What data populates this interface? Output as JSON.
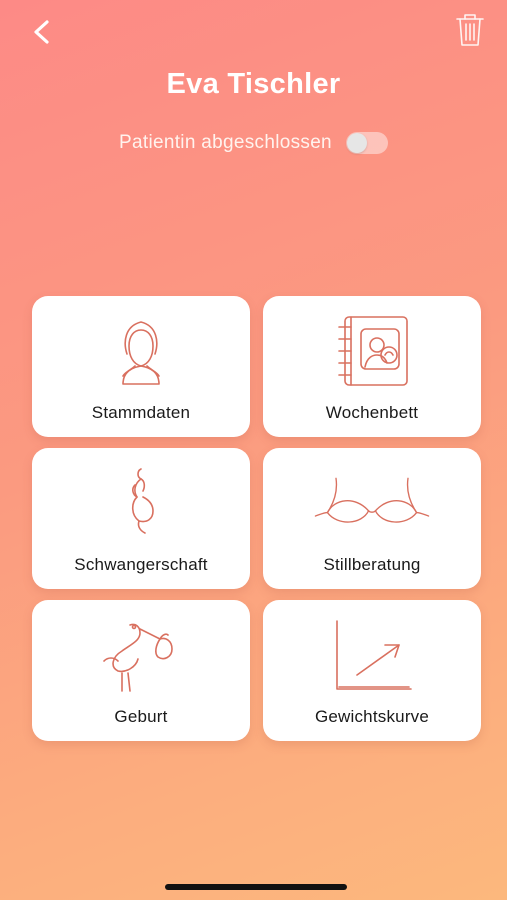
{
  "header": {
    "patient_name": "Eva Tischler",
    "back_icon": "chevron-left-icon",
    "delete_icon": "trash-icon"
  },
  "status": {
    "label": "Patientin abgeschlossen",
    "toggle_on": false
  },
  "tiles": [
    {
      "label": "Stammdaten",
      "icon": "person-portrait-icon"
    },
    {
      "label": "Wochenbett",
      "icon": "address-book-icon"
    },
    {
      "label": "Schwangerschaft",
      "icon": "pregnant-woman-icon"
    },
    {
      "label": "Stillberatung",
      "icon": "bra-icon"
    },
    {
      "label": "Geburt",
      "icon": "stork-icon"
    },
    {
      "label": "Gewichtskurve",
      "icon": "growth-chart-icon"
    }
  ],
  "colors": {
    "gradient_start": "#fd8a86",
    "gradient_end": "#fcb87d",
    "icon_stroke": "#d9705f"
  }
}
